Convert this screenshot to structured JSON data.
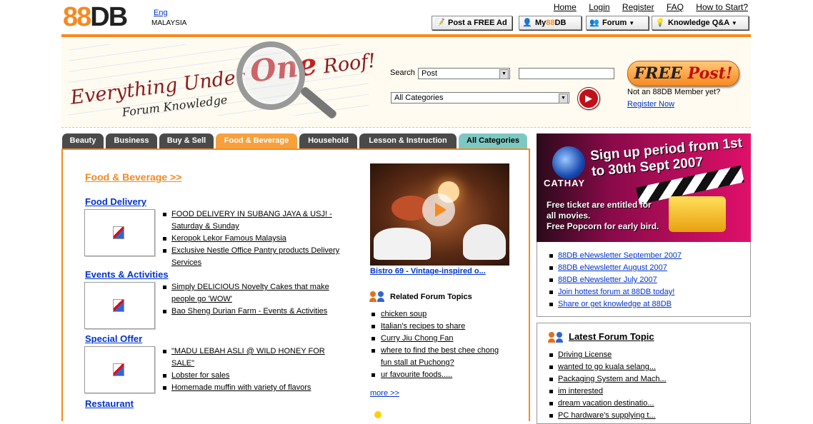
{
  "header": {
    "logo_num": "88",
    "logo_db": "DB",
    "lang_link": "Eng",
    "country": "MALAYSIA",
    "top_links": [
      "Home",
      "Login",
      "Register",
      "FAQ",
      "How to Start?"
    ],
    "buttons": {
      "post_ad": "Post a FREE Ad",
      "my88db_pre": "My",
      "my88db_num": "88",
      "my88db_post": "DB",
      "forum": "Forum",
      "knowledge": "Knowledge Q&A"
    }
  },
  "banner": {
    "slogan_pre": "Everything Under",
    "slogan_one": "One",
    "slogan_post": "Roof!",
    "slogan_sub": "Forum  Knowledge",
    "search_label": "Search",
    "search_type": "Post",
    "search_query": "",
    "category_select": "All Categories",
    "free_post_free": "FREE",
    "free_post_post": "Post!",
    "not_member": "Not an 88DB Member yet?",
    "register_now": "Register Now"
  },
  "tabs": [
    {
      "label": "Beauty"
    },
    {
      "label": "Business"
    },
    {
      "label": "Buy & Sell"
    },
    {
      "label": "Food & Beverage"
    },
    {
      "label": "Household"
    },
    {
      "label": "Lesson & Instruction"
    },
    {
      "label": "All Categories"
    }
  ],
  "main": {
    "section_title": "Food & Beverage >>",
    "categories": [
      {
        "title": "Food Delivery",
        "items": [
          "FOOD DELIVERY IN SUBANG JAYA & USJ! - Saturday & Sunday",
          "Keropok Lekor Famous Malaysia",
          "Exclusive Nestle Office Pantry products Delivery Services"
        ]
      },
      {
        "title": "Events & Activities",
        "items": [
          "Simply DELICIOUS Novelty Cakes that make people go 'WOW'",
          "Bao Sheng Durian Farm - Events & Activities"
        ]
      },
      {
        "title": "Special Offer",
        "items": [
          "\"MADU LEBAH ASLI @ WILD HONEY FOR SALE\"",
          "Lobster for sales",
          "Homemade muffin with variety of flavors"
        ]
      },
      {
        "title": "Restaurant",
        "items": []
      }
    ],
    "video_caption": "Bistro 69 - Vintage-inspired o...",
    "related_title": "Related Forum Topics",
    "related": [
      "chicken soup",
      "Italian's recipes to share",
      "Curry Jiu Chong Fan",
      "where to find the best chee chong fun stall at Puchong?",
      "ur favourite foods....."
    ],
    "more": "more >>"
  },
  "sidebar": {
    "ad": {
      "brand": "CATHAY",
      "headline": "Sign up period from 1st to 30th Sept 2007",
      "line1": "Free ticket are entitled for all movies.",
      "line2": "Free Popcorn for early bird."
    },
    "newsletters": [
      "88DB eNewsletter September 2007",
      "88DB eNewsletter August 2007",
      "88DB eNewsletter July 2007",
      "Join hottest forum at 88DB today!",
      "Share or get knowledge at 88DB"
    ],
    "latest_title": "Latest Forum Topic",
    "latest": [
      "Driving License",
      "wanted to go kuala selang...",
      "Packaging System and Mach...",
      "im interested",
      "dream vacation destinatio...",
      "PC hardware's supplying t..."
    ]
  },
  "colors": {
    "accent": "#f7891f",
    "link": "#0033cc",
    "tab_dark": "#4a4a4a",
    "tab_active": "#f7a03c",
    "tab_all": "#7cc9c4"
  }
}
